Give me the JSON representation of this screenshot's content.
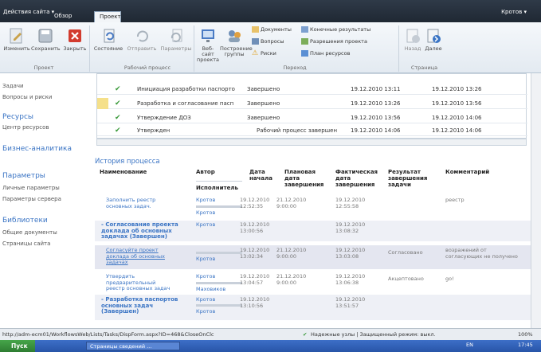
{
  "topbar": {
    "site_actions": "Действия сайта ▾",
    "tab_browse": "Обзор",
    "tab_project": "Проект",
    "user": "Кротов ▾"
  },
  "ribbon": {
    "edit": "Изменить",
    "save": "Сохранить",
    "close": "Закрыть",
    "state": "Состояние",
    "send": "Отправить",
    "params": "Параметры",
    "website1": "Веб-сайт",
    "website2": "проекта",
    "build1": "Построение",
    "build2": "группы",
    "docs": "Документы",
    "issues": "Вопросы",
    "risks": "Риски",
    "results": "Конечные результаты",
    "permissions": "Разрешения проекта",
    "resplan": "План ресурсов",
    "back": "Назад",
    "next": "Далее",
    "g_project": "Проект",
    "g_workflow": "Рабочий процесс",
    "g_nav": "Переход",
    "g_page": "Страница"
  },
  "left": {
    "tasks": "Задачи",
    "issues_risks": "Вопросы и риски",
    "resources": "Ресурсы",
    "resource_center": "Центр ресурсов",
    "bi": "Бизнес-аналитика",
    "params": "Параметры",
    "personal": "Личные параметры",
    "server": "Параметры сервера",
    "libs": "Библиотеки",
    "shared_docs": "Общие документы",
    "site_pages": "Страницы сайта"
  },
  "grid": {
    "rows": [
      {
        "name": "Инициация разработки паспорто",
        "status": "Завершено",
        "start": "19.12.2010 13:11",
        "end": "19.12.2010 13:26"
      },
      {
        "name": "Разработка и согласование пасп",
        "status": "Завершено",
        "start": "19.12.2010 13:26",
        "end": "19.12.2010 13:56"
      },
      {
        "name": "Утверждение ДОЗ",
        "status": "Завершено",
        "start": "19.12.2010 13:56",
        "end": "19.12.2010 14:06"
      },
      {
        "name": "Утвержден",
        "status": "Рабочий процесс завершен",
        "start": "19.12.2010 14:06",
        "end": "19.12.2010 14:06"
      }
    ]
  },
  "history": {
    "title": "История процесса",
    "h_name": "Наименование",
    "h_author": "Автор",
    "h_executor": "Исполнитель",
    "h_start1": "Дата",
    "h_start2": "начала",
    "h_plan1": "Плановая",
    "h_plan2": "дата",
    "h_plan3": "завершения",
    "h_fact1": "Фактическая",
    "h_fact2": "дата",
    "h_fact3": "завершения",
    "h_res1": "Результат",
    "h_res2": "завершения",
    "h_res3": "задачи",
    "h_comment": "Комментарий",
    "r1": {
      "n1": "Заполнить реестр",
      "n2": "основных задач.",
      "author": "Кротов",
      "exec": "Кротов",
      "d1": "19.12.2010",
      "d2": "12:52:35",
      "p1": "21.12.2010",
      "p2": "9:00:00",
      "f1": "19.12.2010",
      "f2": "12:55:58",
      "comment": "реестр"
    },
    "r2": {
      "n1": "- Согласование проекта",
      "n2": "доклада об основных",
      "n3": "задачах (Завершен)",
      "author": "Кротов",
      "d1": "19.12.2010",
      "d2": "13:00:56",
      "f1": "19.12.2010",
      "f2": "13:08:32"
    },
    "r3": {
      "n1": "Согласуйте проект",
      "n2": "доклада об основных",
      "n3": "задачах",
      "exec": "Кротов",
      "d1": "19.12.2010",
      "d2": "13:02:34",
      "p1": "21.12.2010",
      "p2": "9:00:00",
      "f1": "19.12.2010",
      "f2": "13:03:08",
      "result": "Согласовано",
      "c1": "возражений от",
      "c2": "согласующих не получено"
    },
    "r4": {
      "n1": "Утвердить",
      "n2": "предварительный",
      "n3": "реестр основных задач",
      "author": "Кротов",
      "exec": "Маховиков",
      "d1": "19.12.2010",
      "d2": "13:04:57",
      "p1": "21.12.2010",
      "p2": "9:00:00",
      "f1": "19.12.2010",
      "f2": "13:06:38",
      "result": "Акцептовано",
      "comment": "go!"
    },
    "r5": {
      "n1": "- Разработка паспортов",
      "n2": "основных задач",
      "n3": "(Завершен)",
      "author": "Кротов",
      "exec": "Кротов",
      "d1": "19.12.2010",
      "d2": "13:10:56",
      "f1": "19.12.2010",
      "f2": "13:51:57"
    }
  },
  "statusbar": {
    "url": "http://adm-ecm01/WorkflowsWeb/Lists/Tasks/DispForm.aspx?ID=468&CloseOnClc",
    "zone": "Надежные узлы | Защищенный режим: выкл.",
    "zoom": "100%"
  },
  "taskbar": {
    "start": "Пуск",
    "window": "Страницы сведений ...",
    "lang": "EN",
    "time": "17:45"
  }
}
